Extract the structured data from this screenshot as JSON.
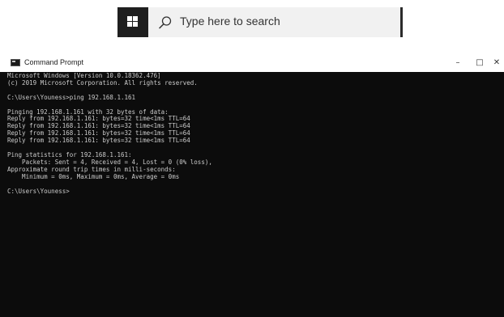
{
  "taskbar": {
    "search_placeholder": "Type here to search",
    "start_icon": "windows-logo-icon",
    "search_icon": "search-icon"
  },
  "window": {
    "title": "Command Prompt",
    "icon": "command-prompt-icon",
    "controls": {
      "minimize": "–",
      "maximize": "□",
      "close": "✕"
    }
  },
  "console": {
    "lines": [
      "Microsoft Windows [Version 10.0.18362.476]",
      "(c) 2019 Microsoft Corporation. All rights reserved.",
      "",
      "C:\\Users\\Youness>ping 192.168.1.161",
      "",
      "Pinging 192.168.1.161 with 32 bytes of data:",
      "Reply from 192.168.1.161: bytes=32 time<1ms TTL=64",
      "Reply from 192.168.1.161: bytes=32 time<1ms TTL=64",
      "Reply from 192.168.1.161: bytes=32 time<1ms TTL=64",
      "Reply from 192.168.1.161: bytes=32 time<1ms TTL=64",
      "",
      "Ping statistics for 192.168.1.161:",
      "    Packets: Sent = 4, Received = 4, Lost = 0 (0% loss),",
      "Approximate round trip times in milli-seconds:",
      "    Minimum = 0ms, Maximum = 0ms, Average = 0ms",
      "",
      "C:\\Users\\Youness>"
    ]
  },
  "colors": {
    "console_bg": "#0c0c0c",
    "console_text": "#cccccc",
    "taskbar_search_bg": "#f1f1f1",
    "start_button_bg": "#1f1f1f"
  }
}
